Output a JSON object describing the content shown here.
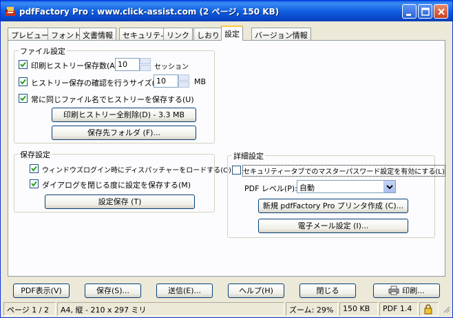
{
  "window": {
    "title": "pdfFactory Pro : www.click-assist.com (2 ページ, 150 KB)"
  },
  "tabs": [
    {
      "label": "プレビュー"
    },
    {
      "label": "フォント"
    },
    {
      "label": "文書情報"
    },
    {
      "label": "セキュリティ"
    },
    {
      "label": "リンク"
    },
    {
      "label": "しおり"
    },
    {
      "label": "設定"
    },
    {
      "label": "バージョン情報"
    }
  ],
  "active_tab": "設定",
  "file_settings": {
    "group_title": "ファイル設定",
    "print_history": {
      "label": "印刷ヒストリー保存数(A):",
      "value": "10",
      "unit": "セッション",
      "checked": true
    },
    "history_confirm": {
      "label": "ヒストリー保存の確認を行うサイズ(B):",
      "value": "10",
      "unit": "MB",
      "checked": true
    },
    "same_name": {
      "label": "常に同じファイル名でヒストリーを保存する(U)",
      "checked": true
    },
    "delete_button": "印刷ヒストリー全削除(D) - 3.3 MB",
    "folder_button": "保存先フォルダ (F)..."
  },
  "save_settings": {
    "group_title": "保存設定",
    "load_dispatcher": {
      "label": "ウィンドウズログイン時にディスパッチャーをロードする(O)",
      "checked": true
    },
    "save_on_close": {
      "label": "ダイアログを閉じる度に設定を保存する(M)",
      "checked": true
    },
    "save_button": "設定保存 (T)"
  },
  "advanced_settings": {
    "group_title": "詳細設定",
    "master_password": {
      "label": "セキュリティータブでのマスターパスワード設定を有効にする(L)",
      "checked": false
    },
    "pdf_level_label": "PDF レベル(P):",
    "pdf_level_value": "自動",
    "new_printer_button": "新規 pdfFactory Pro プリンタ作成 (C)...",
    "email_button": "電子メール設定 (I)..."
  },
  "bottom_buttons": {
    "pdf_view": "PDF表示(V)",
    "save": "保存(S)...",
    "send": "送信(E)...",
    "help": "ヘルプ(H)",
    "close": "閉じる",
    "print": "印刷..."
  },
  "statusbar": {
    "page": "ページ 1 / 2",
    "paper": "A4, 縦 - 210 x 297 ミリ",
    "zoom": "ズーム: 29%",
    "size": "150 KB",
    "pdf_version": "PDF 1.4"
  },
  "icons": {
    "app": "pdffactory-app-icon",
    "printer": "printer-icon",
    "lock": "lock-icon"
  },
  "colors": {
    "titlebar": "#0A5FE6",
    "tab_highlight": "#FFC83C",
    "panel": "#FCFCFE",
    "window_bg": "#ECE9D8"
  }
}
